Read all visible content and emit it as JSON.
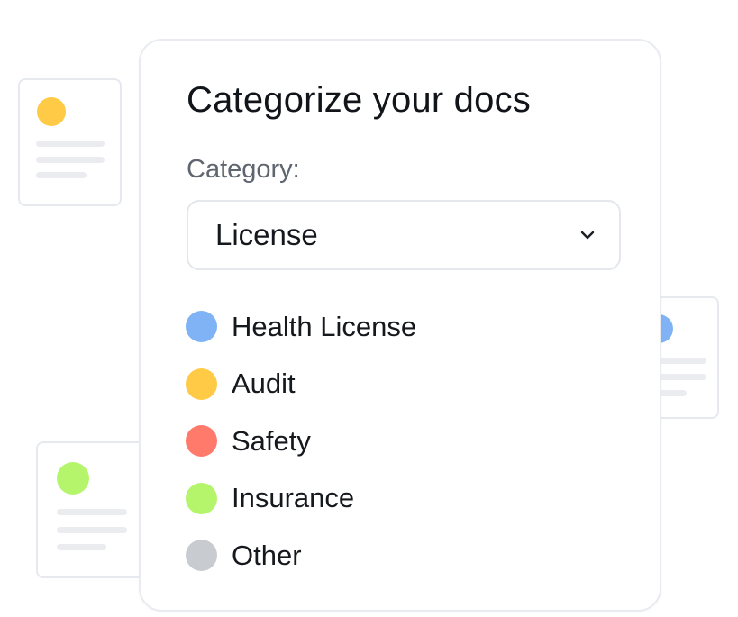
{
  "panel": {
    "title": "Categorize your docs",
    "category_label": "Category:",
    "select": {
      "value": "License",
      "icon": "chevron-down-icon"
    },
    "options": [
      {
        "label": "Health License",
        "color": "#7fb3f5"
      },
      {
        "label": "Audit",
        "color": "#ffcb47"
      },
      {
        "label": "Safety",
        "color": "#ff7a6b"
      },
      {
        "label": "Insurance",
        "color": "#b5f56b"
      },
      {
        "label": "Other",
        "color": "#c8cbd0"
      }
    ]
  },
  "decor_docs": [
    {
      "name": "doc-left-top",
      "dot_color": "#ffcb47"
    },
    {
      "name": "doc-left-bottom",
      "dot_color": "#b5f56b"
    },
    {
      "name": "doc-right",
      "dot_color": "#7fb3f5"
    }
  ]
}
